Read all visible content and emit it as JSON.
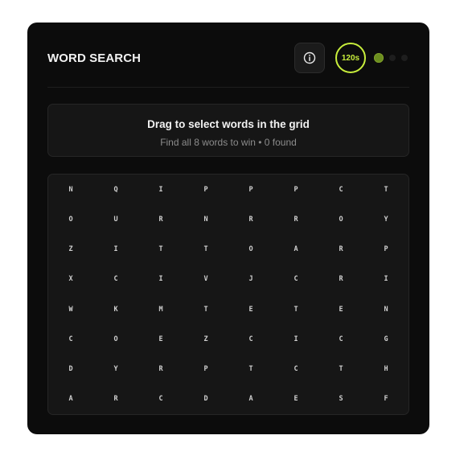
{
  "header": {
    "title": "WORD SEARCH",
    "info_icon": "info-icon",
    "timer": "120s",
    "level_dots": [
      "active",
      "inactive",
      "inactive"
    ]
  },
  "instructions": {
    "title": "Drag to select words in the grid",
    "subtitle": "Find all 8 words to win • 0 found"
  },
  "grid": {
    "rows": [
      [
        "N",
        "Q",
        "I",
        "P",
        "P",
        "P",
        "C",
        "T"
      ],
      [
        "O",
        "U",
        "R",
        "N",
        "R",
        "R",
        "O",
        "Y"
      ],
      [
        "Z",
        "I",
        "T",
        "T",
        "O",
        "A",
        "R",
        "P"
      ],
      [
        "X",
        "C",
        "I",
        "V",
        "J",
        "C",
        "R",
        "I"
      ],
      [
        "W",
        "K",
        "M",
        "T",
        "E",
        "T",
        "E",
        "N"
      ],
      [
        "C",
        "O",
        "E",
        "Z",
        "C",
        "I",
        "C",
        "G"
      ],
      [
        "D",
        "Y",
        "R",
        "P",
        "T",
        "C",
        "T",
        "H"
      ],
      [
        "A",
        "R",
        "C",
        "D",
        "A",
        "E",
        "S",
        "F"
      ]
    ]
  },
  "colors": {
    "accent": "#c8ee3c",
    "card_bg": "#0c0c0c",
    "panel_bg": "#161616"
  }
}
